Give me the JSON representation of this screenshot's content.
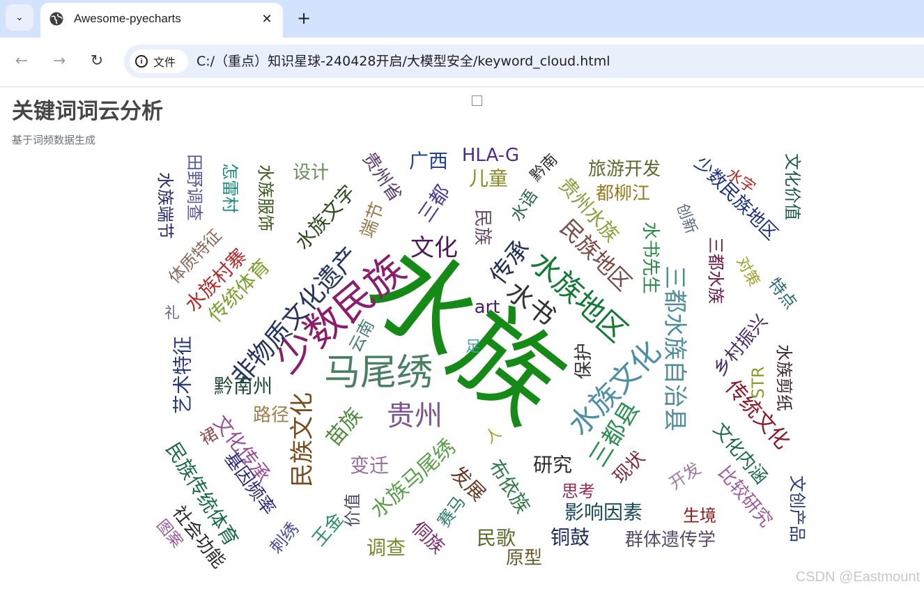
{
  "browser": {
    "tab": {
      "title": "Awesome-pyecharts",
      "close_glyph": "✕",
      "favicon": "globe-icon"
    },
    "new_tab_glyph": "+",
    "tab_search_glyph": "⌄",
    "nav": {
      "back_glyph": "←",
      "forward_glyph": "→",
      "reload_glyph": "↻"
    },
    "omnibox": {
      "site_chip_label": "文件",
      "url": "C:/（重点）知识星球-240428开启/大模型安全/keyword_cloud.html"
    }
  },
  "page": {
    "title": "关键词词云分析",
    "subtitle": "基于词频数据生成",
    "watermark": "CSDN @Eastmount"
  },
  "wordcloud": {
    "words": [
      {
        "text": "水族",
        "color": "#158a17"
      },
      {
        "text": "少数民族",
        "color": "#8c1d6a"
      },
      {
        "text": "马尾绣",
        "color": "#4b7f63"
      },
      {
        "text": "非物质文化遗产",
        "color": "#27345e"
      },
      {
        "text": "水族地区",
        "color": "#137a36"
      },
      {
        "text": "水族文化",
        "color": "#4c8fa6"
      },
      {
        "text": "三都水族自治县",
        "color": "#4f8e9a"
      },
      {
        "text": "水书",
        "color": "#333333"
      },
      {
        "text": "贵州",
        "color": "#7a5590"
      },
      {
        "text": "传承",
        "color": "#222f56"
      },
      {
        "text": "文化",
        "color": "#4d1a57"
      },
      {
        "text": "民族文化",
        "color": "#7a4a1c"
      },
      {
        "text": "水族马尾绣",
        "color": "#5aa04a"
      },
      {
        "text": "民族地区",
        "color": "#7b4a47"
      },
      {
        "text": "三都县",
        "color": "#2d8f52"
      },
      {
        "text": "art",
        "color": "#4a1e74"
      },
      {
        "text": "文化传承",
        "color": "#9a4f96"
      },
      {
        "text": "苗族",
        "color": "#4d8a3b"
      },
      {
        "text": "布依族",
        "color": "#2f7a49"
      },
      {
        "text": "研究",
        "color": "#2a2a2a"
      },
      {
        "text": "发展",
        "color": "#6a3a25"
      },
      {
        "text": "黔南州",
        "color": "#1f4a38"
      },
      {
        "text": "保护",
        "color": "#333333"
      },
      {
        "text": "现状",
        "color": "#7a2a3a"
      },
      {
        "text": "三都",
        "color": "#4b3a94"
      },
      {
        "text": "广西",
        "color": "#23439a"
      },
      {
        "text": "HLA-G",
        "color": "#4a2a94"
      },
      {
        "text": "儿童",
        "color": "#8a8a20"
      },
      {
        "text": "旅游开发",
        "color": "#5a6a2a"
      },
      {
        "text": "都柳江",
        "color": "#9a7a20"
      },
      {
        "text": "少数民族地区",
        "color": "#1c2f7a"
      },
      {
        "text": "文化价值",
        "color": "#1c5a4a"
      },
      {
        "text": "水字",
        "color": "#b22a2a"
      },
      {
        "text": "贵州水族",
        "color": "#8aa03a"
      },
      {
        "text": "民族",
        "color": "#6a4a6a"
      },
      {
        "text": "水语",
        "color": "#2a6a4a"
      },
      {
        "text": "黔南",
        "color": "#2a2a2a"
      },
      {
        "text": "贵州省",
        "color": "#5a3a6a"
      },
      {
        "text": "端节",
        "color": "#9a7a4a"
      },
      {
        "text": "水族文字",
        "color": "#2a4a1a"
      },
      {
        "text": "设计",
        "color": "#6a8a5a"
      },
      {
        "text": "水族服饰",
        "color": "#3a5a1a"
      },
      {
        "text": "怎雷村",
        "color": "#1a8a7a"
      },
      {
        "text": "田野调查",
        "color": "#5a5a9a"
      },
      {
        "text": "水族端节",
        "color": "#2a2a6a"
      },
      {
        "text": "体质特征",
        "color": "#8a6a5a"
      },
      {
        "text": "水族村寨",
        "color": "#b22a2a"
      },
      {
        "text": "传统体育",
        "color": "#7aa02a"
      },
      {
        "text": "礼",
        "color": "#6a6a8a"
      },
      {
        "text": "艺术特征",
        "color": "#2a3a7a"
      },
      {
        "text": "云南",
        "color": "#4a7a7a"
      },
      {
        "text": "足",
        "color": "#4aa0a0"
      },
      {
        "text": "路径",
        "color": "#a0804a"
      },
      {
        "text": "裙",
        "color": "#8a4a4a"
      },
      {
        "text": "民族传统体育",
        "color": "#1a6a4a"
      },
      {
        "text": "基因频率",
        "color": "#2a2a7a"
      },
      {
        "text": "社会功能",
        "color": "#2a2a2a"
      },
      {
        "text": "图案",
        "color": "#9a5a9a"
      },
      {
        "text": "刺绣",
        "color": "#4a4a9a"
      },
      {
        "text": "王金",
        "color": "#2a8a6a"
      },
      {
        "text": "价值",
        "color": "#4a4a6a"
      },
      {
        "text": "调查",
        "color": "#7a8a2a"
      },
      {
        "text": "变迁",
        "color": "#9a6aa0"
      },
      {
        "text": "人",
        "color": "#a0a02a"
      },
      {
        "text": "侗族",
        "color": "#7a2a6a"
      },
      {
        "text": "赛马",
        "color": "#2a7a6a"
      },
      {
        "text": "民歌",
        "color": "#5a6a2a"
      },
      {
        "text": "原型",
        "color": "#6a5a2a"
      },
      {
        "text": "铜鼓",
        "color": "#1a2a5a"
      },
      {
        "text": "思考",
        "color": "#9a2a5a"
      },
      {
        "text": "影响因素",
        "color": "#1a4a5a"
      },
      {
        "text": "群体遗传学",
        "color": "#5a4a6a"
      },
      {
        "text": "生境",
        "color": "#8a1a1a"
      },
      {
        "text": "开发",
        "color": "#a07aa0"
      },
      {
        "text": "比较研究",
        "color": "#a05a9a"
      },
      {
        "text": "文创产品",
        "color": "#2a3a7a"
      },
      {
        "text": "文化内涵",
        "color": "#1a6a4a"
      },
      {
        "text": "传统文化",
        "color": "#8a1a2a"
      },
      {
        "text": "水族剪纸",
        "color": "#3a2a2a"
      },
      {
        "text": "STR",
        "color": "#8aa02a"
      },
      {
        "text": "乡村振兴",
        "color": "#4a2a6a"
      },
      {
        "text": "特点",
        "color": "#2a6a7a"
      },
      {
        "text": "对策",
        "color": "#a0a02a"
      },
      {
        "text": "三都水族",
        "color": "#6a1a4a"
      },
      {
        "text": "创新",
        "color": "#5a6a8a"
      },
      {
        "text": "水书先生",
        "color": "#2a8a4a"
      }
    ]
  }
}
